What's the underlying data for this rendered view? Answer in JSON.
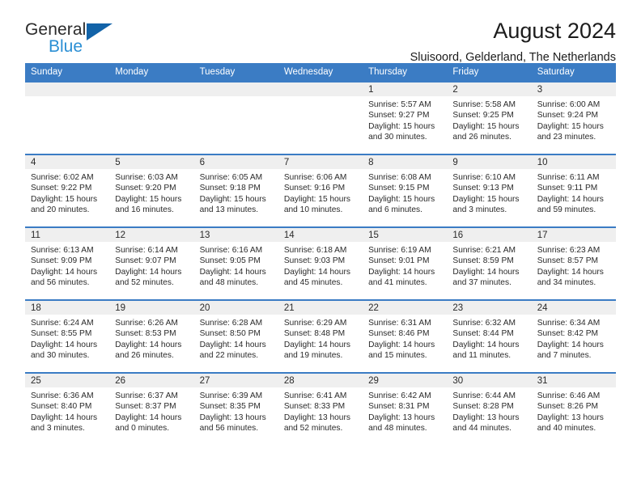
{
  "brand": {
    "name_top": "General",
    "name_bottom": "Blue",
    "triangle_color": "#1263a8",
    "blue_color": "#2b8fd4"
  },
  "header": {
    "title": "August 2024",
    "location": "Sluisoord, Gelderland, The Netherlands"
  },
  "theme": {
    "header_row_bg": "#3b7cc4",
    "daynum_band_bg": "#efefef",
    "text_color": "#2a2a2a"
  },
  "weekdays": [
    "Sunday",
    "Monday",
    "Tuesday",
    "Wednesday",
    "Thursday",
    "Friday",
    "Saturday"
  ],
  "weeks": [
    [
      {
        "day": "",
        "sunrise": "",
        "sunset": "",
        "daylight_line1": "",
        "daylight_line2": ""
      },
      {
        "day": "",
        "sunrise": "",
        "sunset": "",
        "daylight_line1": "",
        "daylight_line2": ""
      },
      {
        "day": "",
        "sunrise": "",
        "sunset": "",
        "daylight_line1": "",
        "daylight_line2": ""
      },
      {
        "day": "",
        "sunrise": "",
        "sunset": "",
        "daylight_line1": "",
        "daylight_line2": ""
      },
      {
        "day": "1",
        "sunrise": "Sunrise: 5:57 AM",
        "sunset": "Sunset: 9:27 PM",
        "daylight_line1": "Daylight: 15 hours",
        "daylight_line2": "and 30 minutes."
      },
      {
        "day": "2",
        "sunrise": "Sunrise: 5:58 AM",
        "sunset": "Sunset: 9:25 PM",
        "daylight_line1": "Daylight: 15 hours",
        "daylight_line2": "and 26 minutes."
      },
      {
        "day": "3",
        "sunrise": "Sunrise: 6:00 AM",
        "sunset": "Sunset: 9:24 PM",
        "daylight_line1": "Daylight: 15 hours",
        "daylight_line2": "and 23 minutes."
      }
    ],
    [
      {
        "day": "4",
        "sunrise": "Sunrise: 6:02 AM",
        "sunset": "Sunset: 9:22 PM",
        "daylight_line1": "Daylight: 15 hours",
        "daylight_line2": "and 20 minutes."
      },
      {
        "day": "5",
        "sunrise": "Sunrise: 6:03 AM",
        "sunset": "Sunset: 9:20 PM",
        "daylight_line1": "Daylight: 15 hours",
        "daylight_line2": "and 16 minutes."
      },
      {
        "day": "6",
        "sunrise": "Sunrise: 6:05 AM",
        "sunset": "Sunset: 9:18 PM",
        "daylight_line1": "Daylight: 15 hours",
        "daylight_line2": "and 13 minutes."
      },
      {
        "day": "7",
        "sunrise": "Sunrise: 6:06 AM",
        "sunset": "Sunset: 9:16 PM",
        "daylight_line1": "Daylight: 15 hours",
        "daylight_line2": "and 10 minutes."
      },
      {
        "day": "8",
        "sunrise": "Sunrise: 6:08 AM",
        "sunset": "Sunset: 9:15 PM",
        "daylight_line1": "Daylight: 15 hours",
        "daylight_line2": "and 6 minutes."
      },
      {
        "day": "9",
        "sunrise": "Sunrise: 6:10 AM",
        "sunset": "Sunset: 9:13 PM",
        "daylight_line1": "Daylight: 15 hours",
        "daylight_line2": "and 3 minutes."
      },
      {
        "day": "10",
        "sunrise": "Sunrise: 6:11 AM",
        "sunset": "Sunset: 9:11 PM",
        "daylight_line1": "Daylight: 14 hours",
        "daylight_line2": "and 59 minutes."
      }
    ],
    [
      {
        "day": "11",
        "sunrise": "Sunrise: 6:13 AM",
        "sunset": "Sunset: 9:09 PM",
        "daylight_line1": "Daylight: 14 hours",
        "daylight_line2": "and 56 minutes."
      },
      {
        "day": "12",
        "sunrise": "Sunrise: 6:14 AM",
        "sunset": "Sunset: 9:07 PM",
        "daylight_line1": "Daylight: 14 hours",
        "daylight_line2": "and 52 minutes."
      },
      {
        "day": "13",
        "sunrise": "Sunrise: 6:16 AM",
        "sunset": "Sunset: 9:05 PM",
        "daylight_line1": "Daylight: 14 hours",
        "daylight_line2": "and 48 minutes."
      },
      {
        "day": "14",
        "sunrise": "Sunrise: 6:18 AM",
        "sunset": "Sunset: 9:03 PM",
        "daylight_line1": "Daylight: 14 hours",
        "daylight_line2": "and 45 minutes."
      },
      {
        "day": "15",
        "sunrise": "Sunrise: 6:19 AM",
        "sunset": "Sunset: 9:01 PM",
        "daylight_line1": "Daylight: 14 hours",
        "daylight_line2": "and 41 minutes."
      },
      {
        "day": "16",
        "sunrise": "Sunrise: 6:21 AM",
        "sunset": "Sunset: 8:59 PM",
        "daylight_line1": "Daylight: 14 hours",
        "daylight_line2": "and 37 minutes."
      },
      {
        "day": "17",
        "sunrise": "Sunrise: 6:23 AM",
        "sunset": "Sunset: 8:57 PM",
        "daylight_line1": "Daylight: 14 hours",
        "daylight_line2": "and 34 minutes."
      }
    ],
    [
      {
        "day": "18",
        "sunrise": "Sunrise: 6:24 AM",
        "sunset": "Sunset: 8:55 PM",
        "daylight_line1": "Daylight: 14 hours",
        "daylight_line2": "and 30 minutes."
      },
      {
        "day": "19",
        "sunrise": "Sunrise: 6:26 AM",
        "sunset": "Sunset: 8:53 PM",
        "daylight_line1": "Daylight: 14 hours",
        "daylight_line2": "and 26 minutes."
      },
      {
        "day": "20",
        "sunrise": "Sunrise: 6:28 AM",
        "sunset": "Sunset: 8:50 PM",
        "daylight_line1": "Daylight: 14 hours",
        "daylight_line2": "and 22 minutes."
      },
      {
        "day": "21",
        "sunrise": "Sunrise: 6:29 AM",
        "sunset": "Sunset: 8:48 PM",
        "daylight_line1": "Daylight: 14 hours",
        "daylight_line2": "and 19 minutes."
      },
      {
        "day": "22",
        "sunrise": "Sunrise: 6:31 AM",
        "sunset": "Sunset: 8:46 PM",
        "daylight_line1": "Daylight: 14 hours",
        "daylight_line2": "and 15 minutes."
      },
      {
        "day": "23",
        "sunrise": "Sunrise: 6:32 AM",
        "sunset": "Sunset: 8:44 PM",
        "daylight_line1": "Daylight: 14 hours",
        "daylight_line2": "and 11 minutes."
      },
      {
        "day": "24",
        "sunrise": "Sunrise: 6:34 AM",
        "sunset": "Sunset: 8:42 PM",
        "daylight_line1": "Daylight: 14 hours",
        "daylight_line2": "and 7 minutes."
      }
    ],
    [
      {
        "day": "25",
        "sunrise": "Sunrise: 6:36 AM",
        "sunset": "Sunset: 8:40 PM",
        "daylight_line1": "Daylight: 14 hours",
        "daylight_line2": "and 3 minutes."
      },
      {
        "day": "26",
        "sunrise": "Sunrise: 6:37 AM",
        "sunset": "Sunset: 8:37 PM",
        "daylight_line1": "Daylight: 14 hours",
        "daylight_line2": "and 0 minutes."
      },
      {
        "day": "27",
        "sunrise": "Sunrise: 6:39 AM",
        "sunset": "Sunset: 8:35 PM",
        "daylight_line1": "Daylight: 13 hours",
        "daylight_line2": "and 56 minutes."
      },
      {
        "day": "28",
        "sunrise": "Sunrise: 6:41 AM",
        "sunset": "Sunset: 8:33 PM",
        "daylight_line1": "Daylight: 13 hours",
        "daylight_line2": "and 52 minutes."
      },
      {
        "day": "29",
        "sunrise": "Sunrise: 6:42 AM",
        "sunset": "Sunset: 8:31 PM",
        "daylight_line1": "Daylight: 13 hours",
        "daylight_line2": "and 48 minutes."
      },
      {
        "day": "30",
        "sunrise": "Sunrise: 6:44 AM",
        "sunset": "Sunset: 8:28 PM",
        "daylight_line1": "Daylight: 13 hours",
        "daylight_line2": "and 44 minutes."
      },
      {
        "day": "31",
        "sunrise": "Sunrise: 6:46 AM",
        "sunset": "Sunset: 8:26 PM",
        "daylight_line1": "Daylight: 13 hours",
        "daylight_line2": "and 40 minutes."
      }
    ]
  ]
}
